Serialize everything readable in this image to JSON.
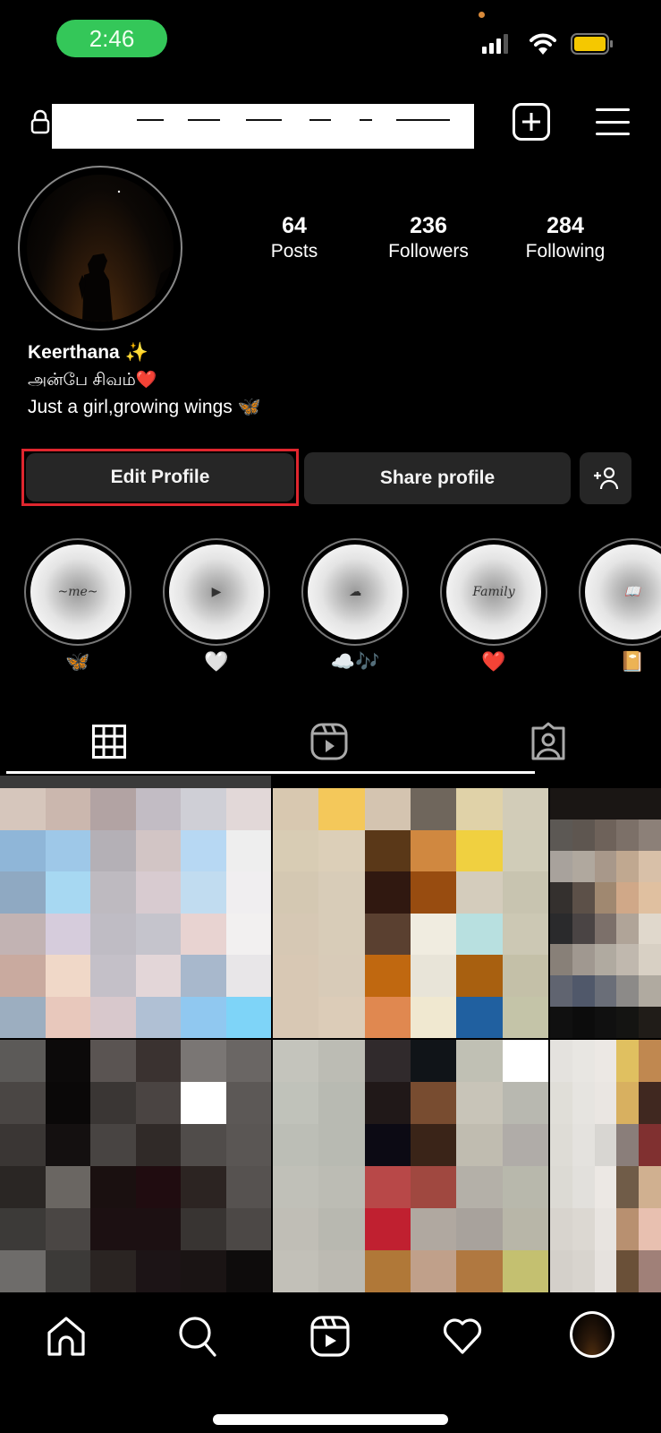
{
  "status_bar": {
    "time": "2:46",
    "signal_bars": 3,
    "signal_total": 4,
    "battery_color": "#f5c800"
  },
  "header": {
    "username_redacted": true,
    "lock_icon": "lock-icon",
    "create_icon": "plus-square-icon",
    "menu_icon": "hamburger-menu-icon"
  },
  "profile": {
    "stats": [
      {
        "value": "64",
        "label": "Posts"
      },
      {
        "value": "236",
        "label": "Followers"
      },
      {
        "value": "284",
        "label": "Following"
      }
    ],
    "name": "Keerthana ✨",
    "bio_line1": "அன்பே சிவம்❤️",
    "bio_line2": "Just a girl,growing wings 🦋"
  },
  "actions": {
    "edit_profile": "Edit Profile",
    "share_profile": "Share profile",
    "add_person_icon": "add-person-icon",
    "highlight_color": "#e0262e"
  },
  "highlights": [
    {
      "cover_text": "~me~",
      "label": "🦋"
    },
    {
      "cover_text": "▶",
      "label": "🤍"
    },
    {
      "cover_text": "☁",
      "label": "☁️🎶"
    },
    {
      "cover_text": "Family",
      "label": "❤️"
    },
    {
      "cover_text": "📖",
      "label": "📔"
    }
  ],
  "tabs": [
    {
      "name": "posts-grid",
      "active": true
    },
    {
      "name": "reels",
      "active": false
    },
    {
      "name": "tagged",
      "active": false
    }
  ],
  "grid_tiles": [
    {
      "cols": 6,
      "colors": [
        "#d6c6bc",
        "#cbb7ae",
        "#b2a3a3",
        "#c2bcc4",
        "#cfcfd6",
        "#e2d8d8",
        "#8fb6d8",
        "#9ec8e8",
        "#b4b0b6",
        "#d2c5c5",
        "#b7d8f3",
        "#eeeeee",
        "#8fa9c2",
        "#a7d8f2",
        "#bebac0",
        "#d8cbd0",
        "#c1dcf0",
        "#f0eef0",
        "#c2b3b3",
        "#d6ccdc",
        "#bfbcc4",
        "#c5c4cc",
        "#e8d3d1",
        "#f2f0f0",
        "#c9aa9f",
        "#f0d8c8",
        "#c4c0c8",
        "#e3d6d8",
        "#a8b8cc",
        "#e8e6e8",
        "#9caec0",
        "#e8c8bc",
        "#d8c8cc",
        "#b0c0d4",
        "#90c8f0",
        "#7ed4f8"
      ]
    },
    {
      "cols": 6,
      "colors": [
        "#d8c8b0",
        "#f4c85a",
        "#d4c4b0",
        "#6f665c",
        "#e0d2a8",
        "#d2ccb8",
        "#d8ccb4",
        "#dccfb8",
        "#5a3818",
        "#d08840",
        "#f0d040",
        "#d0ccb8",
        "#d4c8b2",
        "#d8ccb8",
        "#301810",
        "#984c10",
        "#d4ccbc",
        "#c8c4b0",
        "#d6c8b4",
        "#d8ccb8",
        "#5a4030",
        "#f0ece0",
        "#b8e0e0",
        "#ccc8b4",
        "#d8c8b4",
        "#d8cbb8",
        "#c06810",
        "#e8e4d8",
        "#a86010",
        "#c4c0a8",
        "#d8c8b4",
        "#dcccb8",
        "#e08850",
        "#f0e8d0",
        "#2060a0",
        "#c4c4a8"
      ]
    },
    {
      "cols": 5,
      "colors": [
        "#1a1614",
        "#1a1614",
        "#1a1614",
        "#1a1614",
        "#1a1614",
        "#5c5854",
        "#5e5650",
        "#6e625a",
        "#7c7068",
        "#8c8078",
        "#a8a29c",
        "#b0a89e",
        "#a8988a",
        "#c0a890",
        "#d8c0a8",
        "#34302e",
        "#5c5048",
        "#a08870",
        "#d0a888",
        "#e0c0a0",
        "#2a2a2c",
        "#4a4444",
        "#7c706a",
        "#b0a498",
        "#e0d8cc",
        "#888078",
        "#a09890",
        "#b0aaa0",
        "#c0b8ae",
        "#d8d0c4",
        "#606470",
        "#50586a",
        "#6a6e78",
        "#8c8a88",
        "#b0aaa0",
        "#101010",
        "#0c0c0c",
        "#101010",
        "#141412",
        "#201c18"
      ]
    },
    {
      "cols": 6,
      "colors": [
        "#5c5a58",
        "#0c0a0a",
        "#5a5452",
        "#3a3230",
        "#7a7674",
        "#6a6664",
        "#4a4644",
        "#0a0808",
        "#3a3634",
        "#4a4442",
        "#ffffff",
        "#5c5856",
        "#3a3634",
        "#141010",
        "#484442",
        "#302a28",
        "#504c4a",
        "#5a5654",
        "#2a2624",
        "#6a6662",
        "#1a1010",
        "#200c10",
        "#2c2422",
        "#565250",
        "#3c3a38",
        "#4a4644",
        "#1c1012",
        "#1c1012",
        "#383432",
        "#4c4846",
        "#6e6c6a",
        "#3c3a38",
        "#2a2422",
        "#1c1416",
        "#1a1414",
        "#0e0c0c"
      ]
    },
    {
      "cols": 6,
      "colors": [
        "#c4c4bc",
        "#bcbcb4",
        "#302a2c",
        "#101418",
        "#c0c0b4",
        "#ffffff",
        "#c0c2ba",
        "#b8bab2",
        "#201818",
        "#784c30",
        "#c8c4b8",
        "#b8b8b0",
        "#bcbeb6",
        "#b8bab2",
        "#0c0a14",
        "#3a2418",
        "#c0bcb0",
        "#b0aca8",
        "#c0c0b8",
        "#bcbcb4",
        "#b84848",
        "#a04840",
        "#b4b0a8",
        "#b8b8ac",
        "#c0beb6",
        "#b8b8b0",
        "#c02030",
        "#b0a8a0",
        "#a8a29c",
        "#b8b6a8",
        "#c2c0b8",
        "#bcbab2",
        "#b07838",
        "#c0a08a",
        "#b07840",
        "#c4c070"
      ]
    },
    {
      "cols": 5,
      "colors": [
        "#e4e2de",
        "#e8e6e2",
        "#ece8e4",
        "#e0c060",
        "#c08850",
        "#e0ded8",
        "#e6e4e0",
        "#eae6e2",
        "#d8b060",
        "#402820",
        "#dedcd6",
        "#e4e2de",
        "#d8d6d2",
        "#8a7e7a",
        "#803030",
        "#dcdad4",
        "#e2e0dc",
        "#ece8e4",
        "#705c48",
        "#d0b090",
        "#d8d4ce",
        "#dcd8d2",
        "#e8e4e0",
        "#b89070",
        "#e8c0b0",
        "#d4d0ca",
        "#d8d4ce",
        "#e6e2de",
        "#6a5038",
        "#a08078"
      ]
    }
  ],
  "bottom_nav": [
    {
      "name": "home",
      "icon": "home-icon"
    },
    {
      "name": "search",
      "icon": "search-icon"
    },
    {
      "name": "reels",
      "icon": "reels-icon"
    },
    {
      "name": "activity",
      "icon": "heart-icon"
    },
    {
      "name": "profile",
      "icon": "profile-avatar-icon"
    }
  ]
}
